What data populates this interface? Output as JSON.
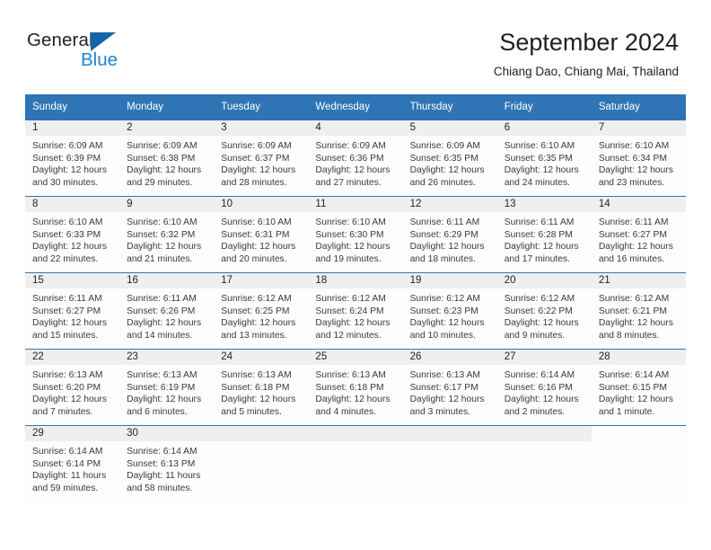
{
  "brand": {
    "name_part1": "General",
    "name_part2": "Blue",
    "accent_color": "#1464aa",
    "blue_text_color": "#1b86d8"
  },
  "header": {
    "title": "September 2024",
    "subtitle": "Chiang Dao, Chiang Mai, Thailand"
  },
  "theme": {
    "header_row_background": "#2f74b5",
    "header_row_text": "#ffffff",
    "day_number_band": "#efefef",
    "row_separator": "#2f74b5"
  },
  "weekdays": [
    "Sunday",
    "Monday",
    "Tuesday",
    "Wednesday",
    "Thursday",
    "Friday",
    "Saturday"
  ],
  "weeks": [
    [
      {
        "day": "1",
        "sunrise": "Sunrise: 6:09 AM",
        "sunset": "Sunset: 6:39 PM",
        "daylight1": "Daylight: 12 hours",
        "daylight2": "and 30 minutes."
      },
      {
        "day": "2",
        "sunrise": "Sunrise: 6:09 AM",
        "sunset": "Sunset: 6:38 PM",
        "daylight1": "Daylight: 12 hours",
        "daylight2": "and 29 minutes."
      },
      {
        "day": "3",
        "sunrise": "Sunrise: 6:09 AM",
        "sunset": "Sunset: 6:37 PM",
        "daylight1": "Daylight: 12 hours",
        "daylight2": "and 28 minutes."
      },
      {
        "day": "4",
        "sunrise": "Sunrise: 6:09 AM",
        "sunset": "Sunset: 6:36 PM",
        "daylight1": "Daylight: 12 hours",
        "daylight2": "and 27 minutes."
      },
      {
        "day": "5",
        "sunrise": "Sunrise: 6:09 AM",
        "sunset": "Sunset: 6:35 PM",
        "daylight1": "Daylight: 12 hours",
        "daylight2": "and 26 minutes."
      },
      {
        "day": "6",
        "sunrise": "Sunrise: 6:10 AM",
        "sunset": "Sunset: 6:35 PM",
        "daylight1": "Daylight: 12 hours",
        "daylight2": "and 24 minutes."
      },
      {
        "day": "7",
        "sunrise": "Sunrise: 6:10 AM",
        "sunset": "Sunset: 6:34 PM",
        "daylight1": "Daylight: 12 hours",
        "daylight2": "and 23 minutes."
      }
    ],
    [
      {
        "day": "8",
        "sunrise": "Sunrise: 6:10 AM",
        "sunset": "Sunset: 6:33 PM",
        "daylight1": "Daylight: 12 hours",
        "daylight2": "and 22 minutes."
      },
      {
        "day": "9",
        "sunrise": "Sunrise: 6:10 AM",
        "sunset": "Sunset: 6:32 PM",
        "daylight1": "Daylight: 12 hours",
        "daylight2": "and 21 minutes."
      },
      {
        "day": "10",
        "sunrise": "Sunrise: 6:10 AM",
        "sunset": "Sunset: 6:31 PM",
        "daylight1": "Daylight: 12 hours",
        "daylight2": "and 20 minutes."
      },
      {
        "day": "11",
        "sunrise": "Sunrise: 6:10 AM",
        "sunset": "Sunset: 6:30 PM",
        "daylight1": "Daylight: 12 hours",
        "daylight2": "and 19 minutes."
      },
      {
        "day": "12",
        "sunrise": "Sunrise: 6:11 AM",
        "sunset": "Sunset: 6:29 PM",
        "daylight1": "Daylight: 12 hours",
        "daylight2": "and 18 minutes."
      },
      {
        "day": "13",
        "sunrise": "Sunrise: 6:11 AM",
        "sunset": "Sunset: 6:28 PM",
        "daylight1": "Daylight: 12 hours",
        "daylight2": "and 17 minutes."
      },
      {
        "day": "14",
        "sunrise": "Sunrise: 6:11 AM",
        "sunset": "Sunset: 6:27 PM",
        "daylight1": "Daylight: 12 hours",
        "daylight2": "and 16 minutes."
      }
    ],
    [
      {
        "day": "15",
        "sunrise": "Sunrise: 6:11 AM",
        "sunset": "Sunset: 6:27 PM",
        "daylight1": "Daylight: 12 hours",
        "daylight2": "and 15 minutes."
      },
      {
        "day": "16",
        "sunrise": "Sunrise: 6:11 AM",
        "sunset": "Sunset: 6:26 PM",
        "daylight1": "Daylight: 12 hours",
        "daylight2": "and 14 minutes."
      },
      {
        "day": "17",
        "sunrise": "Sunrise: 6:12 AM",
        "sunset": "Sunset: 6:25 PM",
        "daylight1": "Daylight: 12 hours",
        "daylight2": "and 13 minutes."
      },
      {
        "day": "18",
        "sunrise": "Sunrise: 6:12 AM",
        "sunset": "Sunset: 6:24 PM",
        "daylight1": "Daylight: 12 hours",
        "daylight2": "and 12 minutes."
      },
      {
        "day": "19",
        "sunrise": "Sunrise: 6:12 AM",
        "sunset": "Sunset: 6:23 PM",
        "daylight1": "Daylight: 12 hours",
        "daylight2": "and 10 minutes."
      },
      {
        "day": "20",
        "sunrise": "Sunrise: 6:12 AM",
        "sunset": "Sunset: 6:22 PM",
        "daylight1": "Daylight: 12 hours",
        "daylight2": "and 9 minutes."
      },
      {
        "day": "21",
        "sunrise": "Sunrise: 6:12 AM",
        "sunset": "Sunset: 6:21 PM",
        "daylight1": "Daylight: 12 hours",
        "daylight2": "and 8 minutes."
      }
    ],
    [
      {
        "day": "22",
        "sunrise": "Sunrise: 6:13 AM",
        "sunset": "Sunset: 6:20 PM",
        "daylight1": "Daylight: 12 hours",
        "daylight2": "and 7 minutes."
      },
      {
        "day": "23",
        "sunrise": "Sunrise: 6:13 AM",
        "sunset": "Sunset: 6:19 PM",
        "daylight1": "Daylight: 12 hours",
        "daylight2": "and 6 minutes."
      },
      {
        "day": "24",
        "sunrise": "Sunrise: 6:13 AM",
        "sunset": "Sunset: 6:18 PM",
        "daylight1": "Daylight: 12 hours",
        "daylight2": "and 5 minutes."
      },
      {
        "day": "25",
        "sunrise": "Sunrise: 6:13 AM",
        "sunset": "Sunset: 6:18 PM",
        "daylight1": "Daylight: 12 hours",
        "daylight2": "and 4 minutes."
      },
      {
        "day": "26",
        "sunrise": "Sunrise: 6:13 AM",
        "sunset": "Sunset: 6:17 PM",
        "daylight1": "Daylight: 12 hours",
        "daylight2": "and 3 minutes."
      },
      {
        "day": "27",
        "sunrise": "Sunrise: 6:14 AM",
        "sunset": "Sunset: 6:16 PM",
        "daylight1": "Daylight: 12 hours",
        "daylight2": "and 2 minutes."
      },
      {
        "day": "28",
        "sunrise": "Sunrise: 6:14 AM",
        "sunset": "Sunset: 6:15 PM",
        "daylight1": "Daylight: 12 hours",
        "daylight2": "and 1 minute."
      }
    ],
    [
      {
        "day": "29",
        "sunrise": "Sunrise: 6:14 AM",
        "sunset": "Sunset: 6:14 PM",
        "daylight1": "Daylight: 11 hours",
        "daylight2": "and 59 minutes."
      },
      {
        "day": "30",
        "sunrise": "Sunrise: 6:14 AM",
        "sunset": "Sunset: 6:13 PM",
        "daylight1": "Daylight: 11 hours",
        "daylight2": "and 58 minutes."
      },
      {
        "day": "",
        "sunrise": "",
        "sunset": "",
        "daylight1": "",
        "daylight2": ""
      },
      {
        "day": "",
        "sunrise": "",
        "sunset": "",
        "daylight1": "",
        "daylight2": ""
      },
      {
        "day": "",
        "sunrise": "",
        "sunset": "",
        "daylight1": "",
        "daylight2": ""
      },
      {
        "day": "",
        "sunrise": "",
        "sunset": "",
        "daylight1": "",
        "daylight2": ""
      },
      {
        "day": "",
        "sunrise": "",
        "sunset": "",
        "daylight1": "",
        "daylight2": "",
        "blank": true
      }
    ]
  ]
}
